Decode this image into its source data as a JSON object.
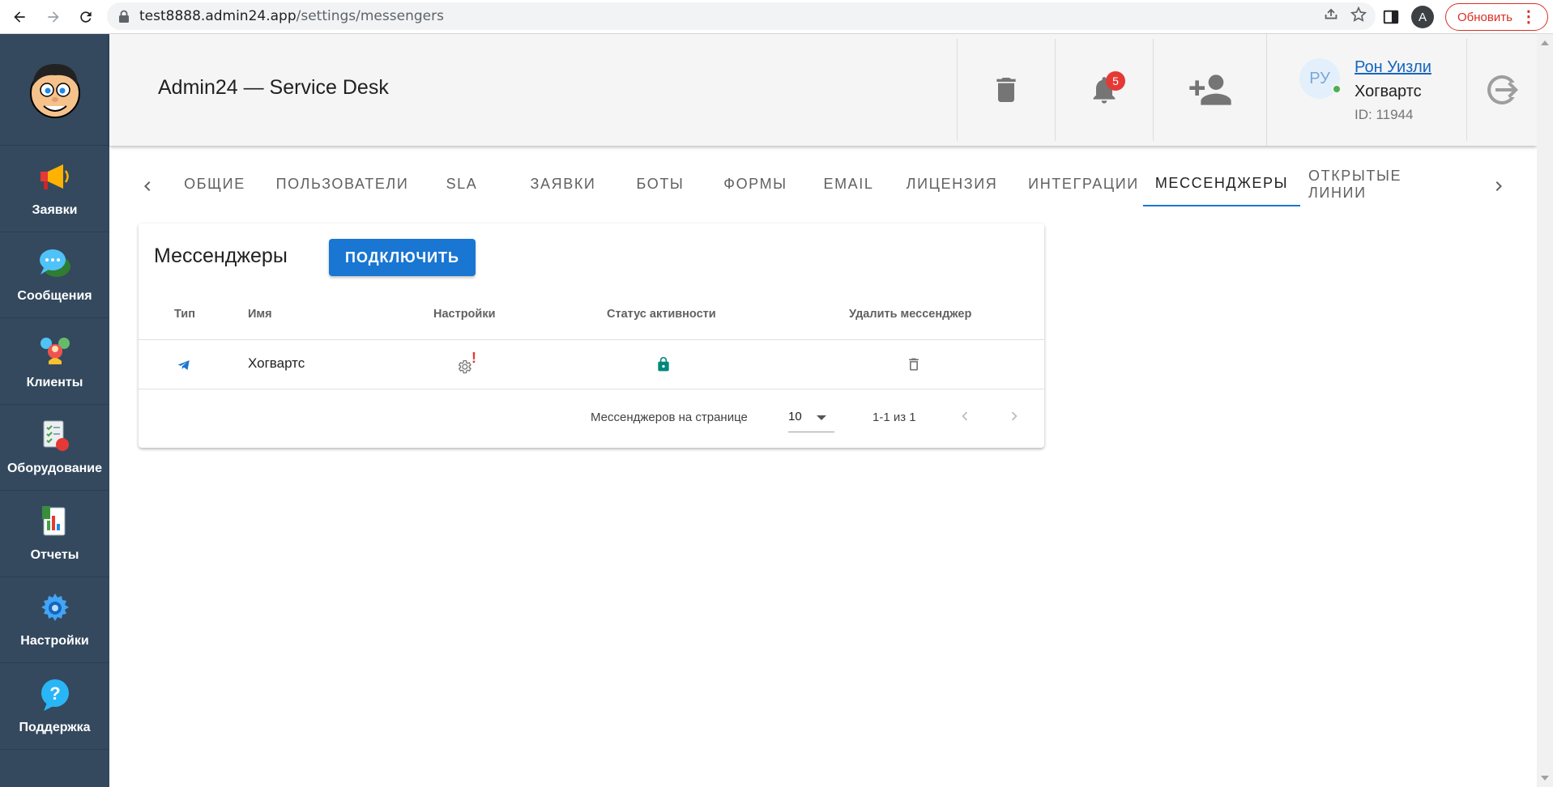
{
  "browser": {
    "url_host": "test8888.admin24.app",
    "url_path": "/settings/messengers",
    "profile_initial": "A",
    "update_label": "Обновить"
  },
  "sidebar": {
    "items": [
      {
        "label": "Заявки",
        "icon": "megaphone-icon"
      },
      {
        "label": "Сообщения",
        "icon": "chat-bubbles-icon"
      },
      {
        "label": "Клиенты",
        "icon": "clients-icon"
      },
      {
        "label": "Оборудование",
        "icon": "equipment-icon"
      },
      {
        "label": "Отчеты",
        "icon": "reports-icon"
      },
      {
        "label": "Настройки",
        "icon": "gear-icon"
      },
      {
        "label": "Поддержка",
        "icon": "help-icon"
      }
    ]
  },
  "header": {
    "title": "Admin24 — Service Desk",
    "notifications_count": "5",
    "user": {
      "initials": "РУ",
      "name": "Рон Уизли",
      "org": "Хогвартс",
      "id": "ID: 11944"
    }
  },
  "tabs": [
    {
      "label": "ОБЩИЕ"
    },
    {
      "label": "ПОЛЬЗОВАТЕЛИ"
    },
    {
      "label": "SLA"
    },
    {
      "label": "ЗАЯВКИ"
    },
    {
      "label": "БОТЫ"
    },
    {
      "label": "ФОРМЫ"
    },
    {
      "label": "EMAIL"
    },
    {
      "label": "ЛИЦЕНЗИЯ"
    },
    {
      "label": "ИНТЕГРАЦИИ"
    },
    {
      "label": "МЕССЕНДЖЕРЫ",
      "active": true
    },
    {
      "label": "ОТКРЫТЫЕ ЛИНИИ"
    }
  ],
  "card": {
    "title": "Мессенджеры",
    "connect_label": "ПОДКЛЮЧИТЬ",
    "columns": [
      "Тип",
      "Имя",
      "Настройки",
      "Статус активности",
      "Удалить мессенджер"
    ],
    "rows": [
      {
        "type_icon": "telegram-icon",
        "name": "Хогвартс",
        "settings_warning": "!",
        "status_icon": "lock-icon",
        "delete_icon": "trash-icon"
      }
    ],
    "footer": {
      "per_page_label": "Мессенджеров на странице",
      "per_page_value": "10",
      "range": "1-1 из 1"
    }
  },
  "colors": {
    "sidebar_bg": "#34495e",
    "accent": "#1976d2",
    "badge": "#e53935",
    "status_ok": "#00897b"
  }
}
